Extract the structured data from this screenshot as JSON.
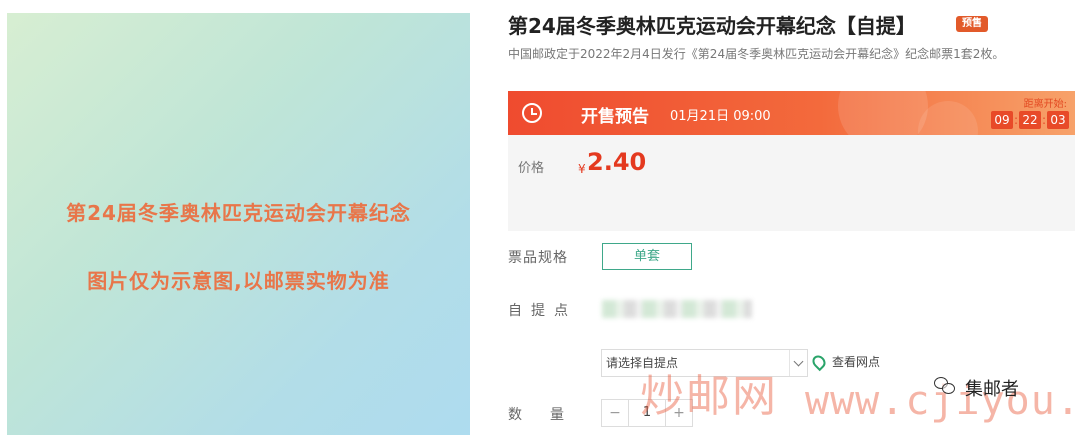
{
  "product_image": {
    "line1": "第24届冬季奥林匹克运动会开幕纪念",
    "line2": "图片仅为示意图,以邮票实物为准"
  },
  "product": {
    "title": "第24届冬季奥林匹克运动会开幕纪念【自提】",
    "badge": "预售",
    "description": "中国邮政定于2022年2月4日发行《第24届冬季奥林匹克运动会开幕纪念》纪念邮票1套2枚。"
  },
  "presale": {
    "label": "开售预告",
    "time": "01月21日 09:00",
    "countdown_label": "距离开始:",
    "countdown": {
      "hours": "09",
      "minutes": "22",
      "seconds": "03"
    }
  },
  "price": {
    "label": "价格",
    "currency": "¥",
    "value": "2.40"
  },
  "spec": {
    "label": "票品规格",
    "option": "单套"
  },
  "pickup": {
    "label": "自提点",
    "select_placeholder": "请选择自提点",
    "view_points": "查看网点"
  },
  "quantity": {
    "label": "数量",
    "minus": "−",
    "value": "1",
    "plus": "+"
  },
  "watermark": {
    "cn": "炒邮网",
    "url": "www.cjiyou.net",
    "wechat_name": "集邮者"
  },
  "colors": {
    "accent": "#e4391f",
    "presale_bar": "#ef4b2f",
    "spec_border": "#3fa88a",
    "image_text": "#e8764a"
  }
}
